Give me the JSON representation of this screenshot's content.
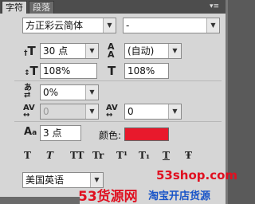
{
  "tabs": [
    "字符",
    "段落"
  ],
  "font_family": "方正彩云简体",
  "font_style": "-",
  "font_size": "30 点",
  "leading": "(自动)",
  "vertical_scale": "108%",
  "horizontal_scale": "108%",
  "tsume": "0%",
  "kerning": "0",
  "tracking": "0",
  "baseline_shift": "3 点",
  "color_label": "颜色:",
  "color_value": "#e8192c",
  "language": "美国英语",
  "style_buttons": [
    "T",
    "T",
    "TT",
    "Tr",
    "T¹",
    "T₁",
    "T",
    "Ŧ"
  ],
  "watermark": {
    "url": "53shop.com",
    "brand": "53货源网",
    "slogan": "淘宝开店货源"
  }
}
